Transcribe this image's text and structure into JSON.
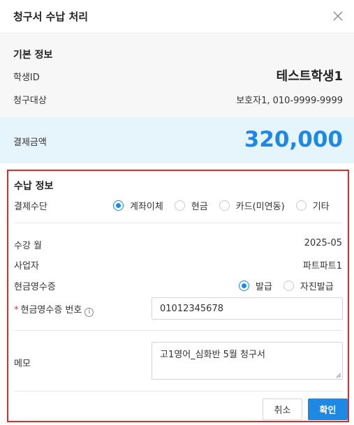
{
  "modal": {
    "title": "청구서 수납 처리",
    "close_icon": "close-icon"
  },
  "basic_info": {
    "title": "기본 정보",
    "student_id_label": "학생ID",
    "student_name": "테스트학생1",
    "billing_target_label": "청구대상",
    "billing_target_value": "보호자1, 010-9999-9999"
  },
  "amount": {
    "label": "결제금액",
    "value": "320,000",
    "color": "#1e88e5"
  },
  "payment": {
    "title": "수납 정보",
    "method_label": "결제수단",
    "methods": [
      {
        "label": "계좌이체",
        "checked": true
      },
      {
        "label": "현금",
        "checked": false
      },
      {
        "label": "카드(미연동)",
        "checked": false
      },
      {
        "label": "기타",
        "checked": false
      }
    ],
    "month_label": "수강 월",
    "month_value": "2025-05",
    "business_label": "사업자",
    "business_value": "파트파트1",
    "receipt_label": "현금영수증",
    "receipt_options": [
      {
        "label": "발급",
        "checked": true
      },
      {
        "label": "자진발급",
        "checked": false
      }
    ],
    "receipt_number_required": "*",
    "receipt_number_label": "현금영수증 번호",
    "receipt_number_info_icon": "info-icon",
    "receipt_number_value": "01012345678",
    "memo_label": "메모",
    "memo_value": "고1영어_심화반 5월 청구서"
  },
  "buttons": {
    "cancel": "취소",
    "confirm": "확인"
  },
  "colors": {
    "accent": "#1e88e5",
    "highlight_border": "#d32f2f",
    "amount_bg": "#e6f4fb",
    "section_bg": "#f7f7f8"
  }
}
